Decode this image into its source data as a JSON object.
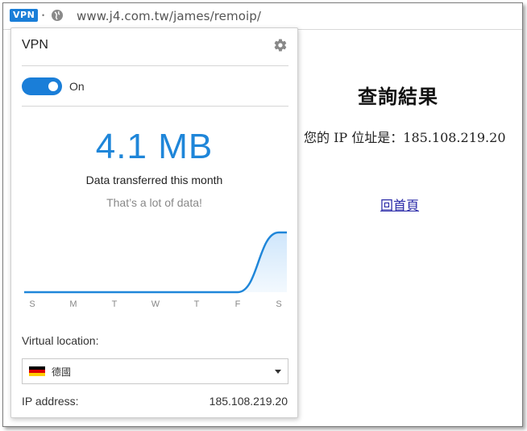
{
  "browser": {
    "vpn_badge": "VPN",
    "url": "www.j4.com.tw/james/remoip/",
    "icons": [
      "globe-icon"
    ]
  },
  "page": {
    "title": "查詢結果",
    "ip_line": "您的 IP 位址是：185.108.219.20",
    "home_link": "回首頁"
  },
  "vpn_popup": {
    "title": "VPN",
    "toggle_label": "On",
    "toggle_on": true,
    "data_amount": "4.1 MB",
    "data_caption": "Data transferred this month",
    "data_note": "That’s a lot of data!",
    "virtual_location_label": "Virtual location:",
    "location_value": "德國",
    "ip_label": "IP address:",
    "ip_value": "185.108.219.20",
    "accent_color": "#1f86d9"
  },
  "chart_data": {
    "type": "area",
    "categories": [
      "S",
      "M",
      "T",
      "W",
      "T",
      "F",
      "S"
    ],
    "values": [
      0,
      0,
      0,
      0,
      0,
      0,
      4.1
    ],
    "title": "",
    "xlabel": "",
    "ylabel": "",
    "grid": false
  }
}
